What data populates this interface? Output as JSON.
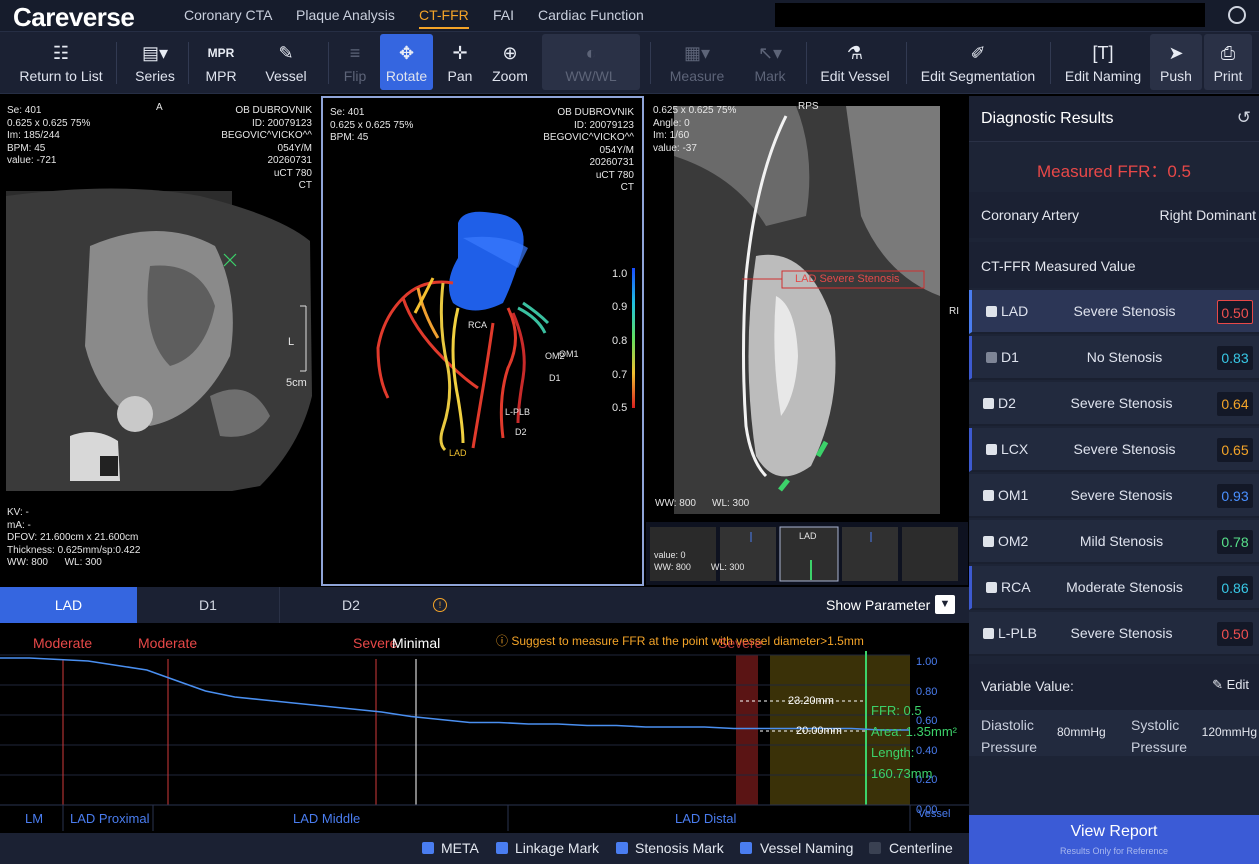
{
  "app": {
    "logo": "Careverse",
    "tabs": [
      "Coronary CTA",
      "Plaque Analysis",
      "CT-FFR",
      "FAI",
      "Cardiac Function"
    ],
    "active_tab": "CT-FFR"
  },
  "toolbar": {
    "return": "Return to List",
    "series": "Series",
    "mpr": "MPR",
    "vessel": "Vessel",
    "flip": "Flip",
    "rotate": "Rotate",
    "pan": "Pan",
    "zoom": "Zoom",
    "wwwl": "WW/WL",
    "measure": "Measure",
    "mark": "Mark",
    "edit_vessel": "Edit Vessel",
    "edit_seg": "Edit Segmentation",
    "edit_naming": "Edit Naming",
    "push": "Push",
    "print": "Print"
  },
  "axial": {
    "orient": "A",
    "side": "L",
    "scale": "5cm",
    "tl": [
      "Se: 401",
      "0.625 x 0.625 75%",
      "Im: 185/244",
      "BPM: 45",
      "value: -721"
    ],
    "tr": [
      "OB DUBROVNIK",
      "ID: 20079123",
      "BEGOVIC^VICKO^^",
      "054Y/M",
      "20260731",
      "uCT 780",
      "CT"
    ],
    "bl": [
      "KV: -",
      "mA: -",
      "DFOV: 21.600cm x 21.600cm",
      "Thickness: 0.625mm/sp:0.422"
    ],
    "ww": "WW: 800",
    "wl": "WL: 300"
  },
  "volume": {
    "tl": [
      "Se: 401",
      "0.625 x 0.625 75%",
      "BPM: 45"
    ],
    "tr": [
      "OB DUBROVNIK",
      "ID: 20079123",
      "BEGOVIC^VICKO^^",
      "054Y/M",
      "20260731",
      "uCT 780",
      "CT"
    ],
    "labels": {
      "rca": "RCA",
      "om2": "OM2",
      "om1": "OM1",
      "d1": "D1",
      "lplb": "L-PLB",
      "d2": "D2",
      "lad": "LAD"
    },
    "scale": [
      "1.0",
      "0.9",
      "0.8",
      "0.7",
      "0.5"
    ]
  },
  "cpr": {
    "tl": [
      "0.625 x 0.625 75%",
      "Angle: 0",
      "Im: 1/60",
      "value: -37"
    ],
    "top": "RPS",
    "right": "RI",
    "annotation": "LAD Severe Stenosis",
    "ww": "WW: 800",
    "wl": "WL: 300",
    "thumb_label": "LAD",
    "thumb_value": "value: 0",
    "thumb_ww": "WW: 800",
    "thumb_wl": "WL: 300"
  },
  "vessel_tabs": [
    "LAD",
    "D1",
    "D2"
  ],
  "show_param": "Show Parameter",
  "chart": {
    "suggest": "Suggest to measure FFR at the point with vessel diameter>1.5mm",
    "labels": [
      "Moderate",
      "Moderate",
      "Severe",
      "Minimal",
      "Severe"
    ],
    "y_ticks": [
      "1.00",
      "0.80",
      "0.60",
      "0.40",
      "0.20",
      "0.00"
    ],
    "dim1": "23.20mm",
    "dim2": "20.00mm",
    "ffr": "FFR: 0.5",
    "area": "Area: 1.35mm²",
    "length": "Length: 160.73mm",
    "segments": [
      "LM",
      "LAD Proximal",
      "LAD Middle",
      "LAD Distal"
    ],
    "vessel": "Vessel"
  },
  "chart_data": {
    "type": "line",
    "xlabel": "",
    "ylabel": "",
    "ylim": [
      0,
      1
    ],
    "values": [
      0.98,
      0.98,
      0.97,
      0.96,
      0.93,
      0.9,
      0.83,
      0.76,
      0.72,
      0.7,
      0.68,
      0.66,
      0.64,
      0.62,
      0.59,
      0.57,
      0.55,
      0.55,
      0.54,
      0.54,
      0.53,
      0.53,
      0.52,
      0.52,
      0.52,
      0.51,
      0.51,
      0.51,
      0.51,
      0.51,
      0.5,
      0.5
    ]
  },
  "checkboxes": [
    {
      "label": "META",
      "on": true
    },
    {
      "label": "Linkage Mark",
      "on": true
    },
    {
      "label": "Stenosis Mark",
      "on": true
    },
    {
      "label": "Vessel Naming",
      "on": true
    },
    {
      "label": "Centerline",
      "on": false
    }
  ],
  "results": {
    "title": "Diagnostic Results",
    "measured": "Measured FFR：0.5",
    "coronary_label": "Coronary Artery",
    "coronary_value": "Right Dominant",
    "measured_title": "CT-FFR Measured Value",
    "arteries": [
      {
        "name": "LAD",
        "status": "Severe Stenosis",
        "value": "0.50",
        "color": "#f05050",
        "checked": true,
        "on": false
      },
      {
        "name": "D1",
        "status": "No Stenosis",
        "value": "0.83",
        "color": "#38c8e6",
        "checked": false,
        "on": false
      },
      {
        "name": "D2",
        "status": "Severe Stenosis",
        "value": "0.64",
        "color": "#f4a428",
        "checked": true,
        "on": true
      },
      {
        "name": "LCX",
        "status": "Severe Stenosis",
        "value": "0.65",
        "color": "#f4a428",
        "checked": true,
        "on": false
      },
      {
        "name": "OM1",
        "status": "Severe Stenosis",
        "value": "0.93",
        "color": "#4a90ff",
        "checked": true,
        "on": true
      },
      {
        "name": "OM2",
        "status": "Mild Stenosis",
        "value": "0.78",
        "color": "#58e08a",
        "checked": true,
        "on": true
      },
      {
        "name": "RCA",
        "status": "Moderate Stenosis",
        "value": "0.86",
        "color": "#38c8e6",
        "checked": true,
        "on": false
      },
      {
        "name": "L-PLB",
        "status": "Severe Stenosis",
        "value": "0.50",
        "color": "#f05050",
        "checked": true,
        "on": true
      }
    ],
    "variable_title": "Variable Value:",
    "edit": "Edit",
    "diastolic": "Diastolic Pressure",
    "diastolic_value": "80mmHg",
    "systolic": "Systolic Pressure",
    "systolic_value": "120mmHg",
    "view_report": "View Report",
    "view_sub": "Results Only for Reference"
  }
}
